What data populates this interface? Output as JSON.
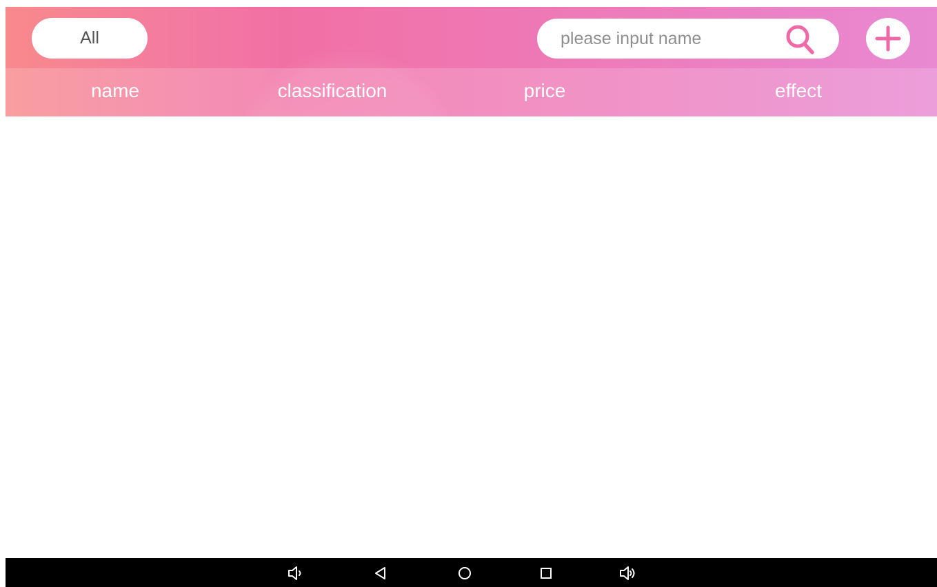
{
  "header": {
    "filter_label": "All",
    "search": {
      "placeholder": "please input name",
      "value": "",
      "icon": "search-icon"
    },
    "add_icon": "plus-icon"
  },
  "table": {
    "columns": [
      "name",
      "classification",
      "price",
      "effect"
    ],
    "rows": []
  },
  "navbar": {
    "icons": [
      "volume-down-icon",
      "back-icon",
      "home-icon",
      "recent-apps-icon",
      "volume-up-icon"
    ]
  },
  "colors": {
    "accent": "#ee6aa6",
    "header_start": "#f8898c",
    "header_end": "#e889d2",
    "navbar": "#000000"
  }
}
